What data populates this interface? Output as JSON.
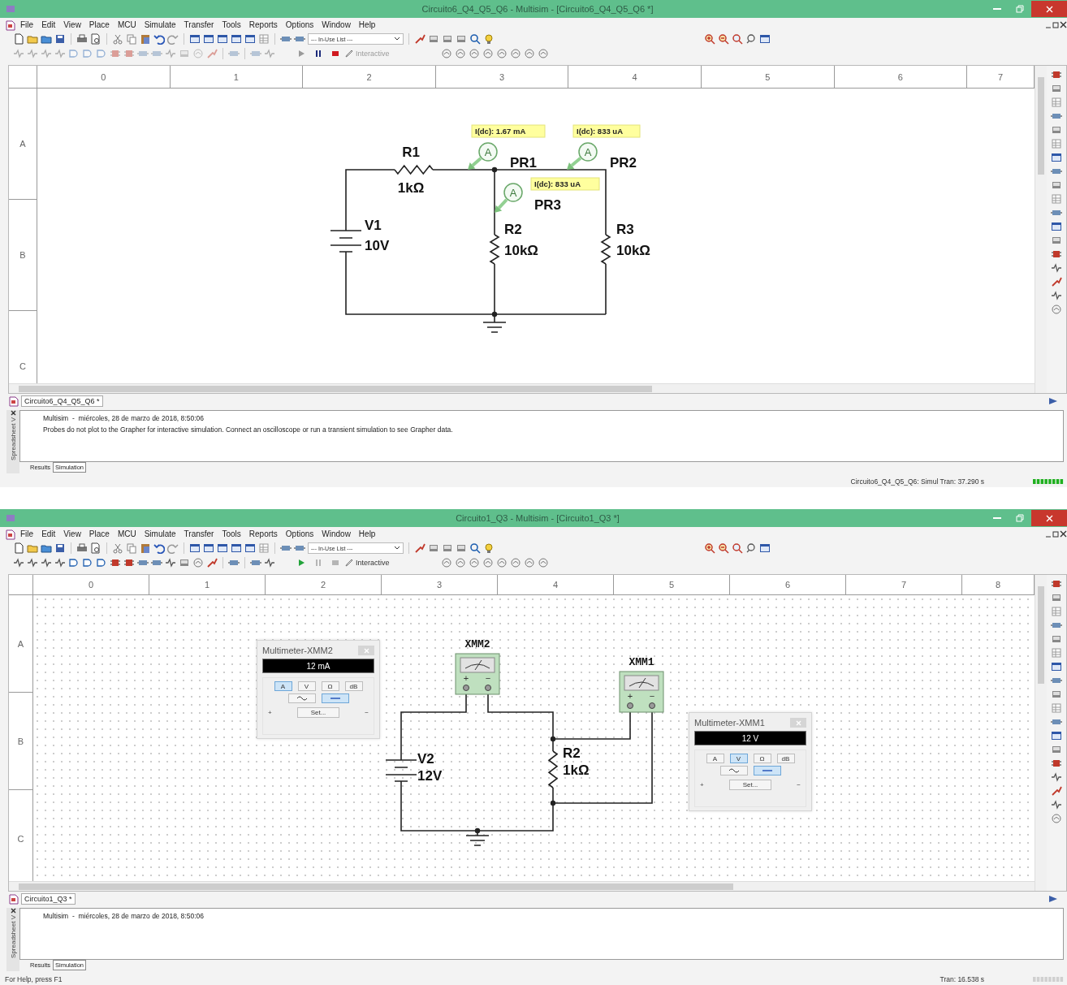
{
  "windows": [
    {
      "title": "Circuito6_Q4_Q5_Q6 - Multisim - [Circuito6_Q4_Q5_Q6 *]",
      "menu": [
        "File",
        "Edit",
        "View",
        "Place",
        "MCU",
        "Simulate",
        "Transfer",
        "Tools",
        "Reports",
        "Options",
        "Window",
        "Help"
      ],
      "in_use_list": "--- In-Use List ---",
      "running": true,
      "interactive": "Interactive",
      "sheet": {
        "kind": "probes",
        "grid": false,
        "columns": [
          "0",
          "1",
          "2",
          "3",
          "4",
          "5",
          "6",
          "7"
        ],
        "rows": [
          "A",
          "B",
          "C"
        ],
        "components": [
          {
            "kind": "battery",
            "ref": "V1",
            "value": "10V"
          },
          {
            "kind": "resistor",
            "ref": "R1",
            "value": "1kΩ"
          },
          {
            "kind": "resistor",
            "ref": "R2",
            "value": "10kΩ"
          },
          {
            "kind": "resistor",
            "ref": "R3",
            "value": "10kΩ"
          },
          {
            "kind": "probe",
            "ref": "PR1",
            "symbol": "A",
            "reading": "I(dc): 1.67 mA"
          },
          {
            "kind": "probe",
            "ref": "PR2",
            "symbol": "A",
            "reading": "I(dc): 833 uA"
          },
          {
            "kind": "probe",
            "ref": "PR3",
            "symbol": "A",
            "reading": "I(dc): 833 uA"
          }
        ]
      },
      "design_tab": "Circuito6_Q4_Q5_Q6 *",
      "spreadsheet": {
        "side_label": "Spreadsheet V",
        "messages": [
          "Multisim  -  miércoles, 28 de marzo de 2018, 8:50:06",
          "Probes do not plot to the Grapher for interactive simulation. Connect an oscilloscope or run a transient simulation to see Grapher data."
        ],
        "tabs": [
          {
            "label": "Results",
            "selected": false
          },
          {
            "label": "Simulation",
            "selected": true
          }
        ]
      },
      "status": {
        "sim": "Circuito6_Q4_Q5_Q6: Simul Tran: 37.290 s"
      }
    },
    {
      "title": "Circuito1_Q3 - Multisim - [Circuito1_Q3 *]",
      "menu": [
        "File",
        "Edit",
        "View",
        "Place",
        "MCU",
        "Simulate",
        "Transfer",
        "Tools",
        "Reports",
        "Options",
        "Window",
        "Help"
      ],
      "in_use_list": "--- In-Use List ---",
      "running": false,
      "interactive": "Interactive",
      "sheet": {
        "kind": "meters",
        "grid": true,
        "columns": [
          "0",
          "1",
          "2",
          "3",
          "4",
          "5",
          "6",
          "7",
          "8"
        ],
        "rows": [
          "A",
          "B",
          "C"
        ],
        "components": [
          {
            "kind": "battery",
            "ref": "V2",
            "value": "12V"
          },
          {
            "kind": "resistor",
            "ref": "R2",
            "value": "1kΩ"
          },
          {
            "kind": "meter",
            "ref": "XMM2",
            "plus": "+",
            "minus": "−"
          },
          {
            "kind": "meter",
            "ref": "XMM1",
            "plus": "+",
            "minus": "−"
          }
        ],
        "instruments": [
          {
            "title": "Multimeter-XMM2",
            "display": "12 mA",
            "modes": [
              {
                "label": "A",
                "selected": true
              },
              {
                "label": "V",
                "selected": false
              },
              {
                "label": "Ω",
                "selected": false
              },
              {
                "label": "dB",
                "selected": false
              }
            ],
            "coupling": [
              {
                "kind": "ac",
                "selected": false
              },
              {
                "kind": "dc",
                "selected": true
              }
            ],
            "set": "Set...",
            "plus": "+",
            "minus": "−"
          },
          {
            "title": "Multimeter-XMM1",
            "display": "12 V",
            "modes": [
              {
                "label": "A",
                "selected": false
              },
              {
                "label": "V",
                "selected": true
              },
              {
                "label": "Ω",
                "selected": false
              },
              {
                "label": "dB",
                "selected": false
              }
            ],
            "coupling": [
              {
                "kind": "ac",
                "selected": false
              },
              {
                "kind": "dc",
                "selected": true
              }
            ],
            "set": "Set...",
            "plus": "+",
            "minus": "−"
          }
        ]
      },
      "design_tab": "Circuito1_Q3 *",
      "spreadsheet": {
        "side_label": "Spreadsheet V",
        "messages": [
          "Multisim  -  miércoles, 28 de marzo de 2018, 8:50:06"
        ],
        "tabs": [
          {
            "label": "Results",
            "selected": false
          },
          {
            "label": "Simulation",
            "selected": true
          }
        ]
      },
      "status": {
        "help": "For Help, press F1",
        "sim": "Tran: 16.538 s"
      }
    }
  ]
}
